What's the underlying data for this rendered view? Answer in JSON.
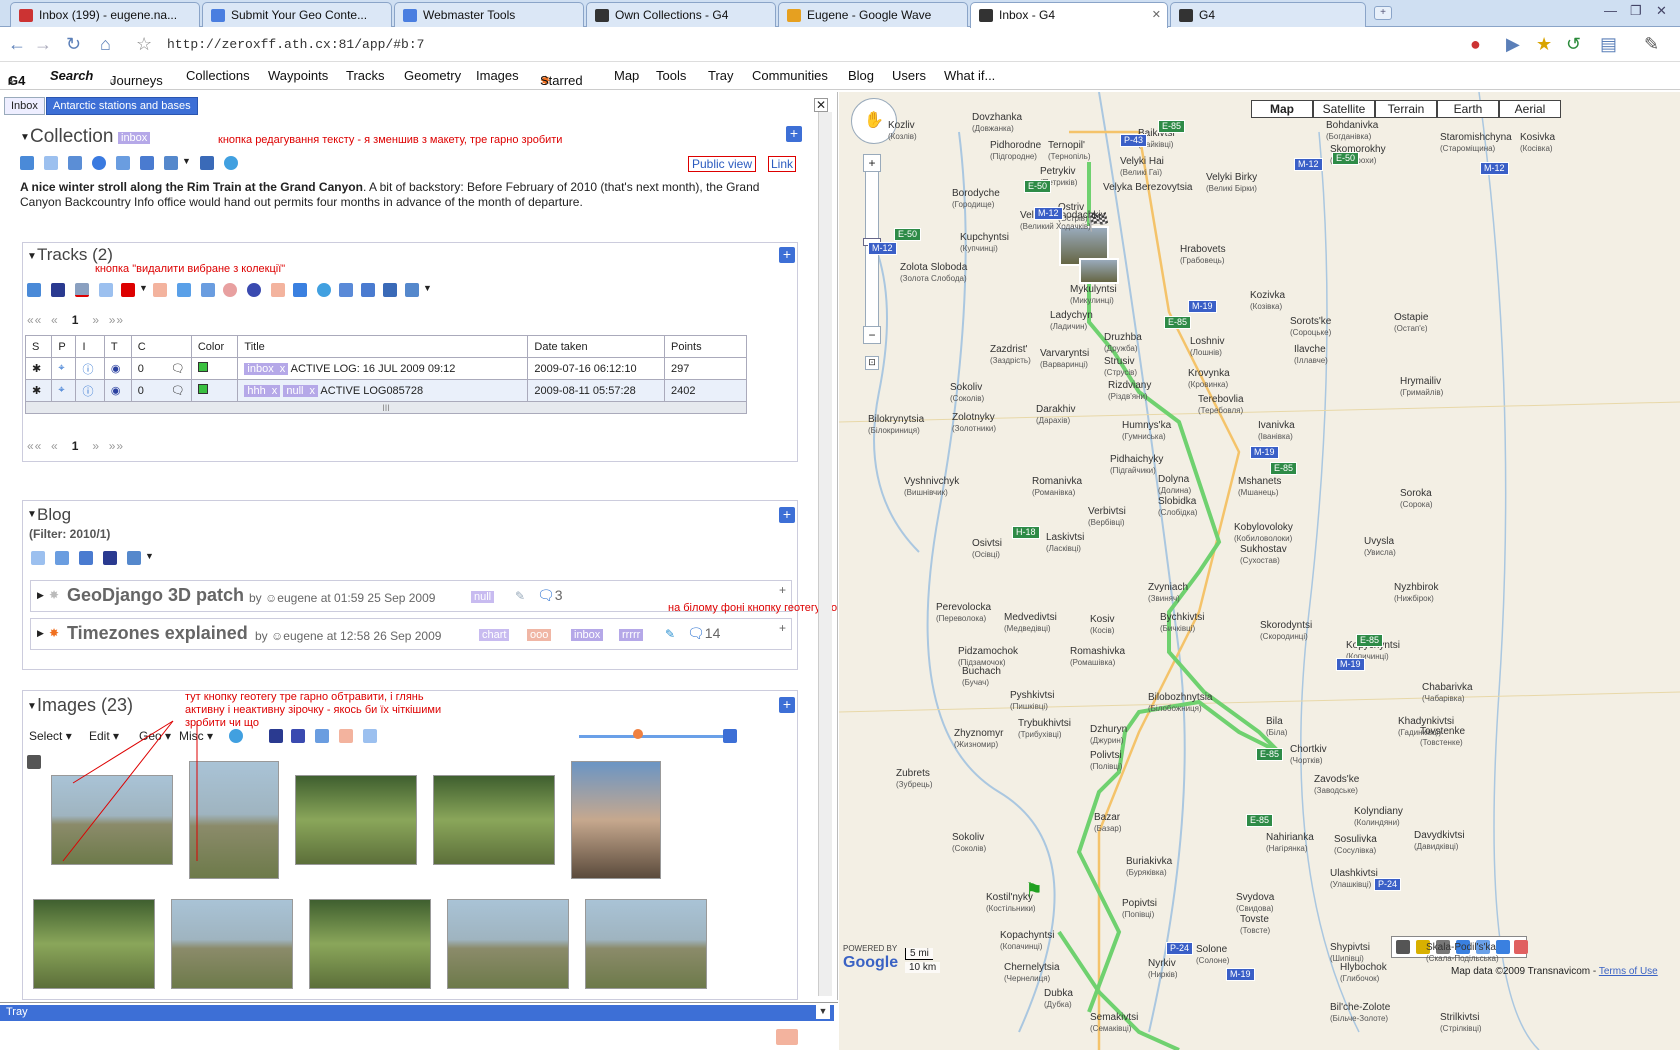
{
  "browser": {
    "tabs": [
      {
        "label": "Inbox (199) - eugene.na...",
        "fav": "#c33",
        "icon": "gmail-icon"
      },
      {
        "label": "Submit Your Geo Conte...",
        "fav": "#4a7ee0",
        "icon": "google-icon"
      },
      {
        "label": "Webmaster Tools",
        "fav": "#4a7ee0",
        "icon": "google-icon"
      },
      {
        "label": "Own Collections - G4",
        "fav": "#333",
        "icon": "paw-icon"
      },
      {
        "label": "Eugene - Google Wave",
        "fav": "#e6a020",
        "icon": "wave-icon"
      },
      {
        "label": "Inbox - G4",
        "fav": "#333",
        "icon": "paw-icon"
      },
      {
        "label": "G4",
        "fav": "#333",
        "icon": "paw-icon"
      }
    ],
    "url": "http://zeroxff.ath.cx:81/app/#b:7"
  },
  "appnav": {
    "brand": "G4",
    "brand_sub": "β",
    "items": [
      "Search",
      "Journeys",
      "Collections",
      "Waypoints",
      "Tracks",
      "Geometry",
      "Images",
      "Starred",
      "Map",
      "Tools",
      "Tray",
      "Communities",
      "Blog",
      "Users",
      "What if..."
    ],
    "journeys_sub": "α"
  },
  "panel_tabs": [
    "Inbox",
    "Antarctic stations and bases"
  ],
  "collection": {
    "title": "Collection",
    "tag": "inbox",
    "public_view": "Public view",
    "link": "Link",
    "note": "кнопка редагування тексту - я зменшив з макету, тре гарно зробити",
    "desc_bold": "A nice winter stroll along the Rim Train at the Grand Canyon",
    "desc_rest": ". A bit of backstory: Before February of 2010 (that's next month), the Grand Canyon Backcountry Info office would hand out permits four months in advance of the month of departure."
  },
  "tracks": {
    "title": "Tracks (2)",
    "note": "кнопка \"видалити вибране з колекції\"",
    "page": "1",
    "headers": [
      "S",
      "P",
      "I",
      "T",
      "C",
      "Color",
      "Title",
      "Date taken",
      "Points"
    ],
    "rows": [
      {
        "c": "0",
        "tags": [
          "inbox"
        ],
        "title": "ACTIVE LOG: 16 JUL 2009 09:12",
        "date": "2009-07-16 06:12:10",
        "points": "297"
      },
      {
        "c": "0",
        "tags": [
          "hhh",
          "null"
        ],
        "title": "ACTIVE LOG085728",
        "date": "2009-08-11 05:57:28",
        "points": "2402"
      }
    ],
    "resize": "III"
  },
  "blog": {
    "title": "Blog",
    "filter": "(Filter: 2010/1)",
    "note": "на білому фоні кнопку геотегу може треба зробити більш помітною",
    "posts": [
      {
        "title": "GeoDjango 3D patch",
        "by": "by",
        "author": "eugene",
        "at": "at 01:59 25 Sep 2009",
        "tags": [
          "null"
        ],
        "comments": "3"
      },
      {
        "title": "Timezones explained",
        "by": "by",
        "author": "eugene",
        "at": "at 12:58 26 Sep 2009",
        "tags": [
          "chart",
          "ooo",
          "inbox",
          "rrrrr"
        ],
        "comments": "14"
      }
    ]
  },
  "images": {
    "title": "Images (23)",
    "note": "тут кнопку геотегу тре гарно обтравити, і глянь активну і неактивну зірочку - якось би їх чіткішими зробити чи що",
    "toolbar": [
      "Select",
      "Edit",
      "Geo",
      "Misc"
    ]
  },
  "tray": {
    "label": "Tray"
  },
  "map": {
    "types": [
      "Map",
      "Satellite",
      "Terrain",
      "Earth",
      "Aerial"
    ],
    "scale_mi": "5 mi",
    "scale_km": "10 km",
    "copyright": "Map data ©2009 Transnavicom -",
    "terms": "Terms of Use",
    "powered": "POWERED BY",
    "logo": "Google",
    "cities": [
      {
        "n": "Ternopil'",
        "s": "(Тернопіль)",
        "l": 1048,
        "t": 48
      },
      {
        "n": "Baikivtsi",
        "s": "(Байківці)",
        "l": 1138,
        "t": 36
      },
      {
        "n": "Kozliv",
        "s": "(Козлів)",
        "l": 888,
        "t": 28
      },
      {
        "n": "Dovzhanka",
        "s": "(Довжанка)",
        "l": 972,
        "t": 20
      },
      {
        "n": "Pidhorodne",
        "s": "(Підгородне)",
        "l": 990,
        "t": 48
      },
      {
        "n": "Petrykiv",
        "s": "(Петриків)",
        "l": 1040,
        "t": 74
      },
      {
        "n": "Velyki Hai",
        "s": "(Великі Гаї)",
        "l": 1120,
        "t": 64
      },
      {
        "n": "Velyki Birky",
        "s": "(Великі Бірки)",
        "l": 1206,
        "t": 80
      },
      {
        "n": "Bohdanivka",
        "s": "(Богданівка)",
        "l": 1326,
        "t": 28
      },
      {
        "n": "Skomorokhy",
        "s": "(Скоморохи)",
        "l": 1330,
        "t": 52
      },
      {
        "n": "Staromishchyna",
        "s": "(Староміщина)",
        "l": 1440,
        "t": 40
      },
      {
        "n": "Kosivka",
        "s": "(Косівка)",
        "l": 1520,
        "t": 40
      },
      {
        "n": "Velyka Berezovytsia",
        "s": "",
        "l": 1103,
        "t": 90
      },
      {
        "n": "Borodyche",
        "s": "(Городище)",
        "l": 952,
        "t": 96
      },
      {
        "n": "Ostriv",
        "s": "(Острів)",
        "l": 1058,
        "t": 110
      },
      {
        "n": "Velykyi Khodachkiv",
        "s": "(Великий Ходачків)",
        "l": 1020,
        "t": 118
      },
      {
        "n": "Kupchyntsi",
        "s": "(Купчинці)",
        "l": 960,
        "t": 140
      },
      {
        "n": "Hrabovets",
        "s": "(Грабовець)",
        "l": 1180,
        "t": 152
      },
      {
        "n": "Zolota Sloboda",
        "s": "(Золота Слобода)",
        "l": 900,
        "t": 170
      },
      {
        "n": "Mykulyntsi",
        "s": "(Микулинці)",
        "l": 1070,
        "t": 192
      },
      {
        "n": "Kozivka",
        "s": "(Козівка)",
        "l": 1250,
        "t": 198
      },
      {
        "n": "Ladychyn",
        "s": "(Ладичин)",
        "l": 1050,
        "t": 218
      },
      {
        "n": "Sorots'ke",
        "s": "(Сороцьке)",
        "l": 1290,
        "t": 224
      },
      {
        "n": "Druzhba",
        "s": "(Дружба)",
        "l": 1104,
        "t": 240
      },
      {
        "n": "Loshniv",
        "s": "(Лошнів)",
        "l": 1190,
        "t": 244
      },
      {
        "n": "Ostapie",
        "s": "(Остап'є)",
        "l": 1394,
        "t": 220
      },
      {
        "n": "Zazdrist'",
        "s": "(Заздрість)",
        "l": 990,
        "t": 252
      },
      {
        "n": "Varvaryntsi",
        "s": "(Варваринці)",
        "l": 1040,
        "t": 256
      },
      {
        "n": "Strusiv",
        "s": "(Струсів)",
        "l": 1104,
        "t": 264
      },
      {
        "n": "Rizdviany",
        "s": "(Різдв'яни)",
        "l": 1108,
        "t": 288
      },
      {
        "n": "Krovynka",
        "s": "(Кровинка)",
        "l": 1188,
        "t": 276
      },
      {
        "n": "Ilavche",
        "s": "(Іллавче)",
        "l": 1294,
        "t": 252
      },
      {
        "n": "Sokoliv",
        "s": "(Соколів)",
        "l": 950,
        "t": 290
      },
      {
        "n": "Terebovlia",
        "s": "(Теребовля)",
        "l": 1198,
        "t": 302
      },
      {
        "n": "Hrymailiv",
        "s": "(Гримайлів)",
        "l": 1400,
        "t": 284
      },
      {
        "n": "Darakhiv",
        "s": "(Дарахів)",
        "l": 1036,
        "t": 312
      },
      {
        "n": "Zolotnyky",
        "s": "(Золотники)",
        "l": 952,
        "t": 320
      },
      {
        "n": "Bilokrynytsia",
        "s": "(Білокриниця)",
        "l": 868,
        "t": 322
      },
      {
        "n": "Humnys'ka",
        "s": "(Гумниська)",
        "l": 1122,
        "t": 328
      },
      {
        "n": "Ivanivka",
        "s": "(Іванівка)",
        "l": 1258,
        "t": 328
      },
      {
        "n": "Pidhaichyky",
        "s": "(Підгайчики)",
        "l": 1110,
        "t": 362
      },
      {
        "n": "Dolyna",
        "s": "(Долина)",
        "l": 1158,
        "t": 382
      },
      {
        "n": "Mshanets",
        "s": "(Мшанець)",
        "l": 1238,
        "t": 384
      },
      {
        "n": "Vyshnivchyk",
        "s": "(Вишнівчик)",
        "l": 904,
        "t": 384
      },
      {
        "n": "Romanivka",
        "s": "(Романівка)",
        "l": 1032,
        "t": 384
      },
      {
        "n": "Verbivtsi",
        "s": "(Вербівці)",
        "l": 1088,
        "t": 414
      },
      {
        "n": "Slobidka",
        "s": "(Слобідка)",
        "l": 1158,
        "t": 404
      },
      {
        "n": "Kobylovoloky",
        "s": "(Кобиловолоки)",
        "l": 1234,
        "t": 430
      },
      {
        "n": "Soroka",
        "s": "(Сорока)",
        "l": 1400,
        "t": 396
      },
      {
        "n": "Osivtsi",
        "s": "(Осівці)",
        "l": 972,
        "t": 446
      },
      {
        "n": "Laskivtsi",
        "s": "(Ласківці)",
        "l": 1046,
        "t": 440
      },
      {
        "n": "Sukhostav",
        "s": "(Сухостав)",
        "l": 1240,
        "t": 452
      },
      {
        "n": "Uvysla",
        "s": "(Увисла)",
        "l": 1364,
        "t": 444
      },
      {
        "n": "Zvyniach",
        "s": "(Звиняч)",
        "l": 1148,
        "t": 490
      },
      {
        "n": "Nyzhbirok",
        "s": "(Нижбірок)",
        "l": 1394,
        "t": 490
      },
      {
        "n": "Kosiv",
        "s": "(Косів)",
        "l": 1090,
        "t": 522
      },
      {
        "n": "Bychkivtsi",
        "s": "(Бичківці)",
        "l": 1160,
        "t": 520
      },
      {
        "n": "Medvedivtsi",
        "s": "(Медведівці)",
        "l": 1004,
        "t": 520
      },
      {
        "n": "Perevolocka",
        "s": "(Переволока)",
        "l": 936,
        "t": 510
      },
      {
        "n": "Kopychyntsi",
        "s": "(Копичинці)",
        "l": 1346,
        "t": 548
      },
      {
        "n": "Skorodyntsi",
        "s": "(Скородинці)",
        "l": 1260,
        "t": 528
      },
      {
        "n": "Romashivka",
        "s": "(Ромашівка)",
        "l": 1070,
        "t": 554
      },
      {
        "n": "Pidzamochok",
        "s": "(Підзамочок)",
        "l": 958,
        "t": 554
      },
      {
        "n": "Buchach",
        "s": "(Бучач)",
        "l": 962,
        "t": 574
      },
      {
        "n": "Pyshkivtsi",
        "s": "(Пишківці)",
        "l": 1010,
        "t": 598
      },
      {
        "n": "Bilobozhnytsia",
        "s": "(Білобожниця)",
        "l": 1148,
        "t": 600
      },
      {
        "n": "Chabarivka",
        "s": "(Чабарівка)",
        "l": 1422,
        "t": 590
      },
      {
        "n": "Trybukhivtsi",
        "s": "(Трибухівці)",
        "l": 1018,
        "t": 626
      },
      {
        "n": "Dzhuryn",
        "s": "(Джурин)",
        "l": 1090,
        "t": 632
      },
      {
        "n": "Bila",
        "s": "(Біла)",
        "l": 1266,
        "t": 624
      },
      {
        "n": "Khadynkivtsi",
        "s": "(Гадинківці)",
        "l": 1398,
        "t": 624
      },
      {
        "n": "Zhyznomyr",
        "s": "(Жизномир)",
        "l": 954,
        "t": 636
      },
      {
        "n": "Chortkiv",
        "s": "(Чортків)",
        "l": 1290,
        "t": 652
      },
      {
        "n": "Tovstenke",
        "s": "(Товстенке)",
        "l": 1420,
        "t": 634
      },
      {
        "n": "Polivtsi",
        "s": "(Полівці)",
        "l": 1090,
        "t": 658
      },
      {
        "n": "Zubrets",
        "s": "(Зубрець)",
        "l": 896,
        "t": 676
      },
      {
        "n": "Zavods'ke",
        "s": "(Заводське)",
        "l": 1314,
        "t": 682
      },
      {
        "n": "Kolyndiany",
        "s": "(Колиндяни)",
        "l": 1354,
        "t": 714
      },
      {
        "n": "Bazar",
        "s": "(Базар)",
        "l": 1094,
        "t": 720
      },
      {
        "n": "Sokoliv",
        "s": "(Соколів)",
        "l": 952,
        "t": 740
      },
      {
        "n": "Nahirianka",
        "s": "(Нагірянка)",
        "l": 1266,
        "t": 740
      },
      {
        "n": "Sosulivka",
        "s": "(Сосулівка)",
        "l": 1334,
        "t": 742
      },
      {
        "n": "Davydkivtsi",
        "s": "(Давидківці)",
        "l": 1414,
        "t": 738
      },
      {
        "n": "Buriakivka",
        "s": "(Бурякiвка)",
        "l": 1126,
        "t": 764
      },
      {
        "n": "Ulashkivtsi",
        "s": "(Улашківці)",
        "l": 1330,
        "t": 776
      },
      {
        "n": "Svydova",
        "s": "(Свидова)",
        "l": 1236,
        "t": 800
      },
      {
        "n": "Kostil'nyky",
        "s": "(Костільники)",
        "l": 986,
        "t": 800
      },
      {
        "n": "Popivtsi",
        "s": "(Попівці)",
        "l": 1122,
        "t": 806
      },
      {
        "n": "Tovste",
        "s": "(Товсте)",
        "l": 1240,
        "t": 822
      },
      {
        "n": "Shypivtsi",
        "s": "(Шипівці)",
        "l": 1330,
        "t": 850
      },
      {
        "n": "Skala-Podil's'ka",
        "s": "(Скала-Подільська)",
        "l": 1426,
        "t": 850
      },
      {
        "n": "Kopachyntsi",
        "s": "(Копачинці)",
        "l": 1000,
        "t": 838
      },
      {
        "n": "Nyrkiv",
        "s": "(Нирків)",
        "l": 1148,
        "t": 866
      },
      {
        "n": "Solone",
        "s": "(Солоне)",
        "l": 1196,
        "t": 852
      },
      {
        "n": "Hlybochok",
        "s": "(Глибочок)",
        "l": 1340,
        "t": 870
      },
      {
        "n": "Chernelytsia",
        "s": "(Чернелиця)",
        "l": 1004,
        "t": 870
      },
      {
        "n": "Dubka",
        "s": "(Дубка)",
        "l": 1044,
        "t": 896
      },
      {
        "n": "Bil'che-Zolote",
        "s": "(Більче-Золоте)",
        "l": 1330,
        "t": 910
      },
      {
        "n": "Strilkivtsi",
        "s": "(Стрілківці)",
        "l": 1440,
        "t": 920
      },
      {
        "n": "Semakivtsi",
        "s": "(Семаківці)",
        "l": 1090,
        "t": 920
      }
    ],
    "roads": [
      {
        "n": "E-85",
        "c": "g",
        "l": 1158,
        "t": 28
      },
      {
        "n": "P-43",
        "c": "b",
        "l": 1120,
        "t": 42
      },
      {
        "n": "M-12",
        "c": "b",
        "l": 1294,
        "t": 66
      },
      {
        "n": "E-50",
        "c": "g",
        "l": 1332,
        "t": 60
      },
      {
        "n": "M-12",
        "c": "b",
        "l": 1480,
        "t": 70
      },
      {
        "n": "E-50",
        "c": "g",
        "l": 1024,
        "t": 88
      },
      {
        "n": "M-12",
        "c": "b",
        "l": 1034,
        "t": 115
      },
      {
        "n": "E-50",
        "c": "g",
        "l": 894,
        "t": 136
      },
      {
        "n": "M-12",
        "c": "b",
        "l": 868,
        "t": 150
      },
      {
        "n": "M-19",
        "c": "b",
        "l": 1188,
        "t": 208
      },
      {
        "n": "E-85",
        "c": "g",
        "l": 1164,
        "t": 224
      },
      {
        "n": "M-19",
        "c": "b",
        "l": 1250,
        "t": 354
      },
      {
        "n": "E-85",
        "c": "g",
        "l": 1270,
        "t": 370
      },
      {
        "n": "H-18",
        "c": "g",
        "l": 1012,
        "t": 434
      },
      {
        "n": "E-85",
        "c": "g",
        "l": 1356,
        "t": 542
      },
      {
        "n": "M-19",
        "c": "b",
        "l": 1336,
        "t": 566
      },
      {
        "n": "E-85",
        "c": "g",
        "l": 1256,
        "t": 656
      },
      {
        "n": "E-85",
        "c": "g",
        "l": 1246,
        "t": 722
      },
      {
        "n": "P-24",
        "c": "b",
        "l": 1374,
        "t": 786
      },
      {
        "n": "P-24",
        "c": "b",
        "l": 1166,
        "t": 850
      },
      {
        "n": "M-19",
        "c": "b",
        "l": 1226,
        "t": 876
      }
    ]
  }
}
